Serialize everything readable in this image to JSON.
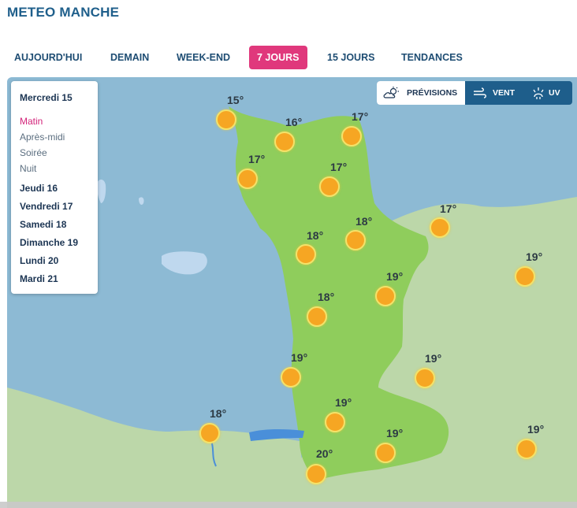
{
  "header": {
    "title": "METEO MANCHE"
  },
  "nav": {
    "tabs": [
      {
        "label": "AUJOURD'HUI",
        "active": false
      },
      {
        "label": "DEMAIN",
        "active": false
      },
      {
        "label": "WEEK-END",
        "active": false
      },
      {
        "label": "7 JOURS",
        "active": true
      },
      {
        "label": "15 JOURS",
        "active": false
      },
      {
        "label": "TENDANCES",
        "active": false
      }
    ]
  },
  "day_panel": {
    "current_day": "Mercredi 15",
    "slots": [
      {
        "label": "Matin",
        "active": true
      },
      {
        "label": "Après-midi",
        "active": false
      },
      {
        "label": "Soirée",
        "active": false
      },
      {
        "label": "Nuit",
        "active": false
      }
    ],
    "days": [
      "Jeudi 16",
      "Vendredi 17",
      "Samedi 18",
      "Dimanche 19",
      "Lundi 20",
      "Mardi 21"
    ]
  },
  "map_toggle": {
    "buttons": [
      {
        "label": "PRÉVISIONS",
        "icon": "partly-cloudy-icon",
        "active": true
      },
      {
        "label": "VENT",
        "icon": "wind-icon",
        "active": false
      },
      {
        "label": "UV",
        "icon": "uv-icon",
        "active": false
      }
    ]
  },
  "forecast": {
    "icon": "sun-icon",
    "points": [
      {
        "temp": "15°"
      },
      {
        "temp": "16°"
      },
      {
        "temp": "17°"
      },
      {
        "temp": "17°"
      },
      {
        "temp": "17°"
      },
      {
        "temp": "17°"
      },
      {
        "temp": "18°"
      },
      {
        "temp": "18°"
      },
      {
        "temp": "19°"
      },
      {
        "temp": "18°"
      },
      {
        "temp": "19°"
      },
      {
        "temp": "19°"
      },
      {
        "temp": "19°"
      },
      {
        "temp": "19°"
      },
      {
        "temp": "18°"
      },
      {
        "temp": "19°"
      },
      {
        "temp": "19°"
      },
      {
        "temp": "20°"
      }
    ]
  },
  "colors": {
    "sea": "#8dbad4",
    "land_highlight": "#8fcd5c",
    "land_neighbor": "#bcd7a9",
    "accent": "#e0387c",
    "brand": "#1e5e8b"
  }
}
